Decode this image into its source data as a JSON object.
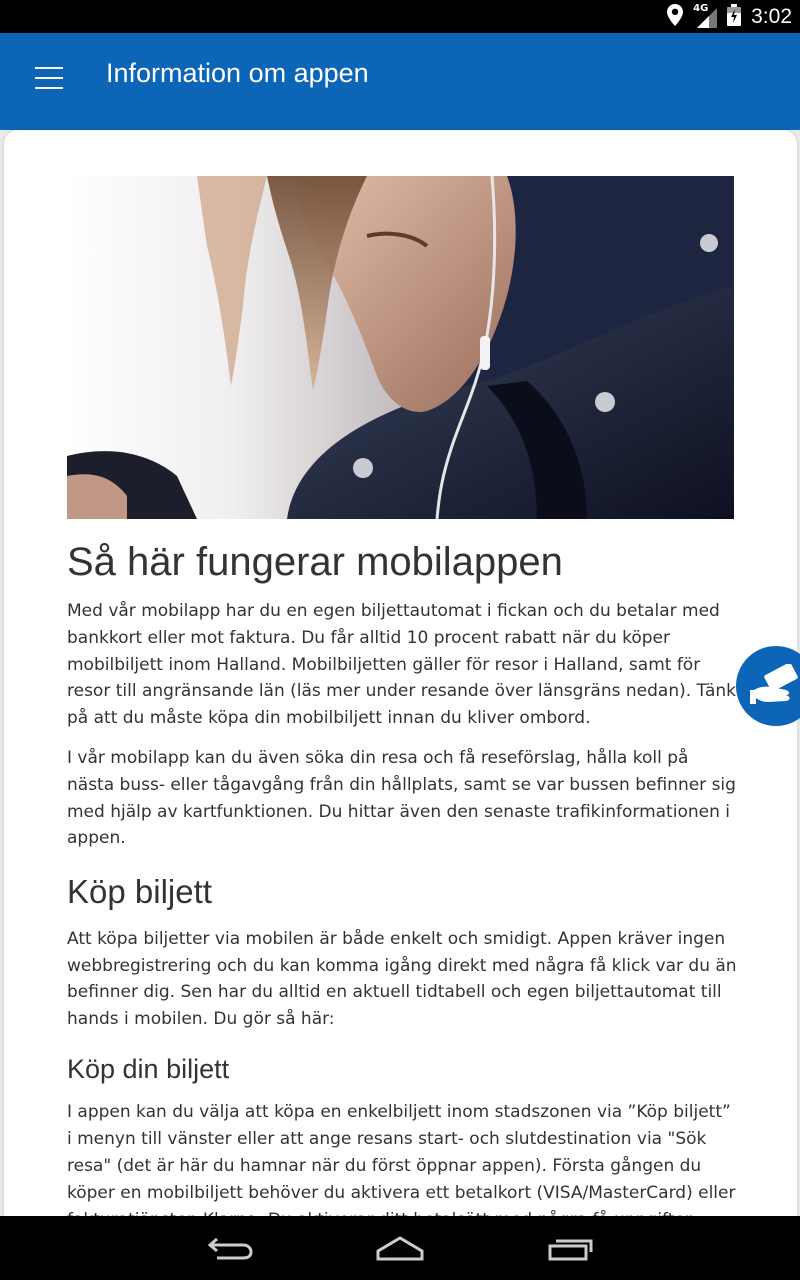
{
  "status_bar": {
    "time": "3:02",
    "network_label": "4G",
    "icons": [
      "location-icon",
      "signal-icon",
      "battery-icon"
    ]
  },
  "app_bar": {
    "title": "Information om appen",
    "menu_icon": "hamburger-menu-icon"
  },
  "article": {
    "heading": "Så här fungerar mobilappen",
    "intro_1": "Med vår mobilapp har du en egen biljettautomat i fickan och du betalar med bankkort eller mot faktura. Du får alltid 10 procent rabatt när du köper mobilbiljett inom Halland. Mobilbiljetten gäller för resor i Halland, samt för resor till angränsande län (läs mer under resande över länsgräns nedan). Tänk på att du måste köpa din mobilbiljett innan du kliver ombord.",
    "intro_2": "I vår mobilapp kan du även söka din resa och få reseförslag, hålla koll på nästa buss- eller tågavgång från din hållplats, samt se var bussen befinner sig med hjälp av kartfunktionen. Du hittar även den senaste trafikinformationen i appen.",
    "section_heading": "Köp biljett",
    "section_text": "Att köpa biljetter via mobilen är både enkelt och smidigt. Appen kräver ingen webbregistrering och du kan komma igång direkt med några få klick var du än befinner dig. Sen har du alltid en aktuell tidtabell och egen biljettautomat till hands i mobilen. Du gör så här:",
    "sub_heading": "Köp din biljett",
    "sub_text": "I appen kan du välja att köpa en enkelbiljett inom stadszonen via ”Köp biljett” i menyn till vänster eller att ange resans start- och slutdestination via \"Sök resa\" (det är här du hamnar när du först öppnar appen). Första gången du köper en mobilbiljett behöver du aktivera ett betalkort (VISA/MasterCard) eller fakturatjänsten Klarna. Du aktiverar ditt betalsätt med några få uppgifter direkt i"
  },
  "fab": {
    "icon": "ticket-hand-icon"
  },
  "nav_bar": {
    "icons": [
      "back-icon",
      "home-icon",
      "recents-icon"
    ]
  },
  "colors": {
    "primary": "#0c65b6",
    "text": "#333333",
    "background": "#ffffff"
  }
}
